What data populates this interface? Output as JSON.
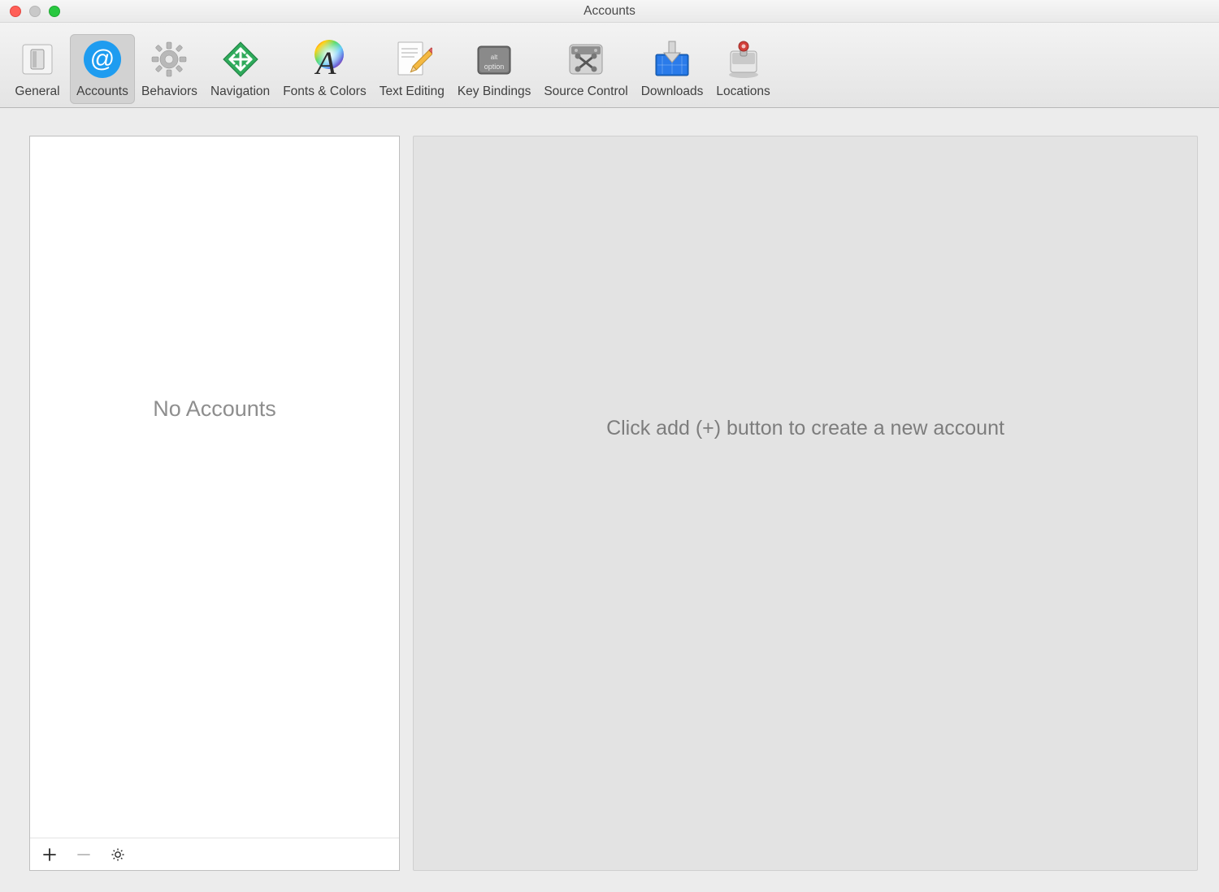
{
  "window": {
    "title": "Accounts"
  },
  "toolbar": {
    "items": [
      {
        "id": "general",
        "label": "General",
        "icon": "general-icon",
        "selected": false
      },
      {
        "id": "accounts",
        "label": "Accounts",
        "icon": "at-icon",
        "selected": true
      },
      {
        "id": "behaviors",
        "label": "Behaviors",
        "icon": "gear-icon",
        "selected": false
      },
      {
        "id": "navigation",
        "label": "Navigation",
        "icon": "navigation-icon",
        "selected": false
      },
      {
        "id": "fonts-colors",
        "label": "Fonts & Colors",
        "icon": "fonts-colors-icon",
        "selected": false
      },
      {
        "id": "text-editing",
        "label": "Text Editing",
        "icon": "text-editing-icon",
        "selected": false
      },
      {
        "id": "key-bindings",
        "label": "Key Bindings",
        "icon": "key-bindings-icon",
        "selected": false
      },
      {
        "id": "source-control",
        "label": "Source Control",
        "icon": "source-control-icon",
        "selected": false
      },
      {
        "id": "downloads",
        "label": "Downloads",
        "icon": "downloads-icon",
        "selected": false
      },
      {
        "id": "locations",
        "label": "Locations",
        "icon": "locations-icon",
        "selected": false
      }
    ]
  },
  "left": {
    "empty_message": "No Accounts",
    "footer": {
      "add_label": "+",
      "remove_label": "−",
      "settings_label": "⚙"
    }
  },
  "right": {
    "message": "Click add (+) button to create a new account"
  },
  "colors": {
    "accent_blue": "#1e9cf0",
    "accent_green": "#2faa5b"
  }
}
